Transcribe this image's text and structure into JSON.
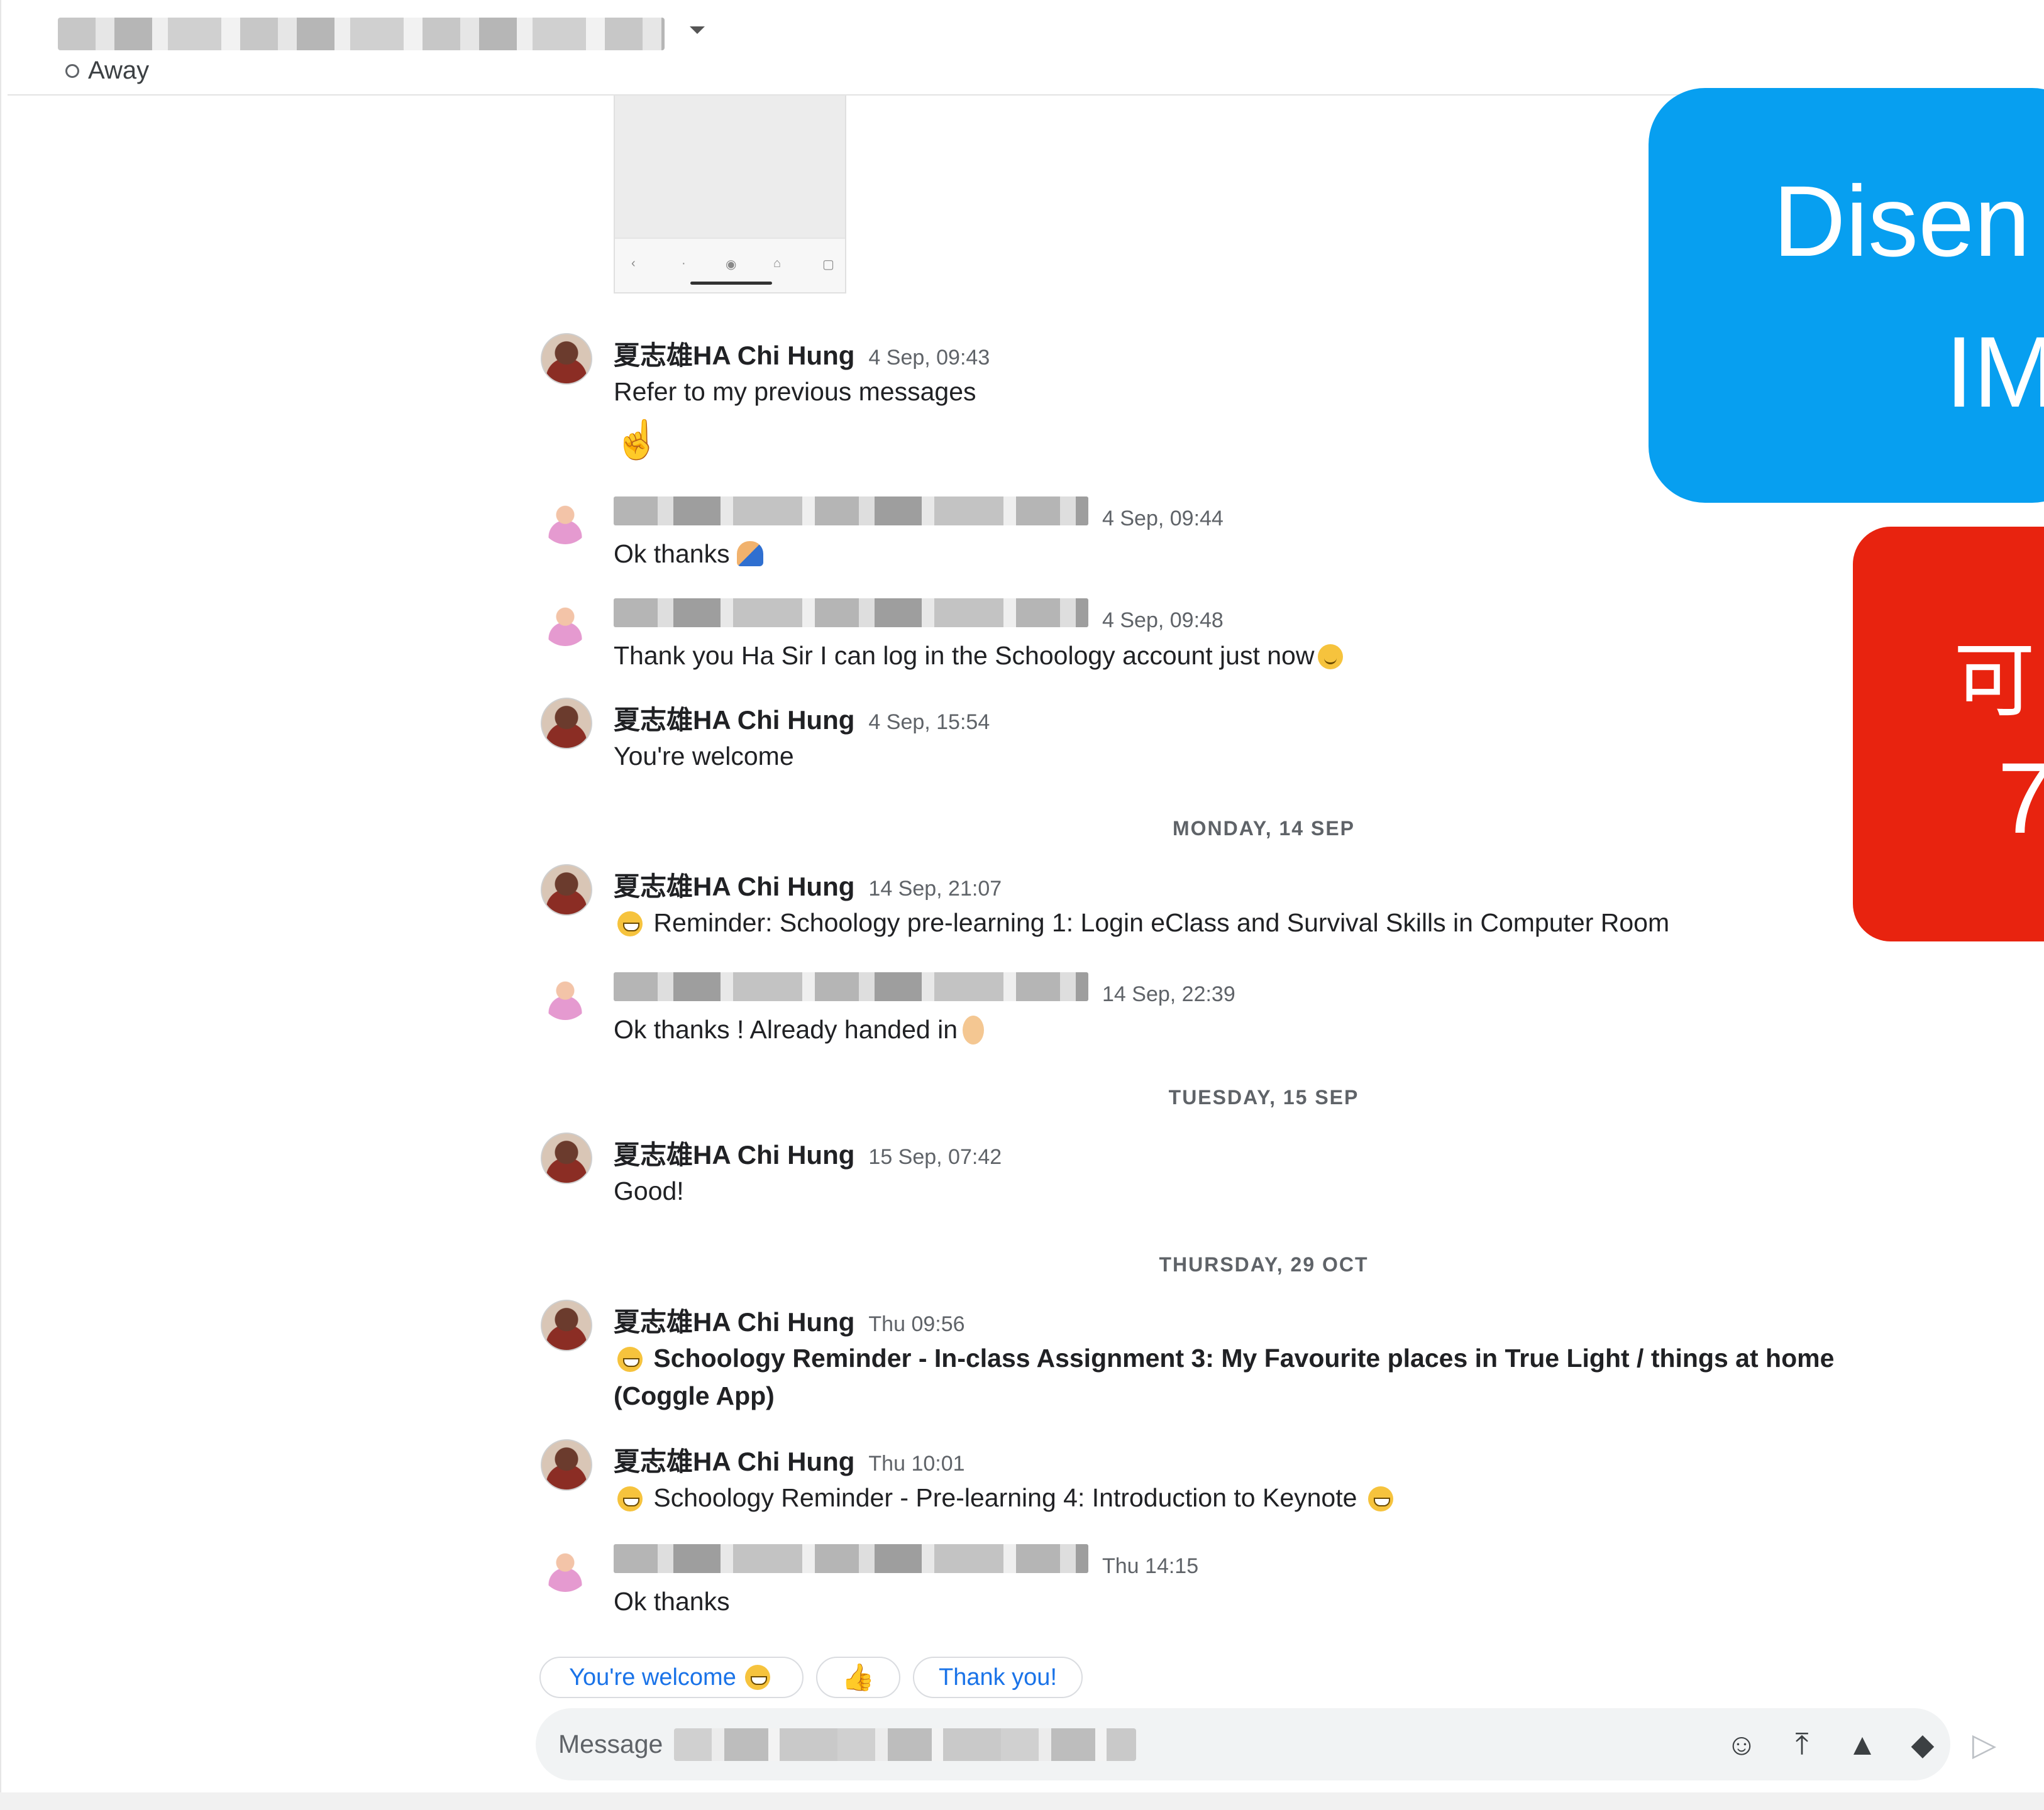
{
  "header": {
    "status": "Away"
  },
  "thumbnail": {
    "nav_symbols": [
      "‹",
      "·",
      "◉",
      "⌂",
      "▢"
    ]
  },
  "messages": [
    {
      "sender": "夏志雄HA Chi Hung",
      "time": "4 Sep, 09:43",
      "text": "Refer to my previous messages",
      "extra": "pointing-up-emoji"
    },
    {
      "sender": "",
      "time": "4 Sep, 09:44",
      "text": "Ok thanks",
      "extra": "folded-hands-emoji"
    },
    {
      "sender": "",
      "time": "4 Sep, 09:48",
      "text": "Thank you Ha Sir I can log in the Schoology account just now",
      "extra": "smiling-emoji"
    },
    {
      "sender": "夏志雄HA Chi Hung",
      "time": "4 Sep, 15:54",
      "text": "You're welcome"
    },
    {
      "sender": "夏志雄HA Chi Hung",
      "time": "14 Sep, 21:07",
      "text": "Reminder: Schoology pre-learning 1: Login eClass and Survival Skills in Computer Room",
      "extra": "grinning-emoji"
    },
    {
      "sender": "",
      "time": "14 Sep, 22:39",
      "text": "Ok thanks ! Already handed in",
      "extra": "ok-hand-emoji"
    },
    {
      "sender": "夏志雄HA Chi Hung",
      "time": "15 Sep, 07:42",
      "text": "Good!"
    },
    {
      "sender": "夏志雄HA Chi Hung",
      "time": "Thu 09:56",
      "text": "Schoology Reminder - In-class Assignment 3: My Favourite places in True Light / things at home",
      "text2": "(Coggle App)",
      "extra": "grinning-emoji"
    },
    {
      "sender": "夏志雄HA Chi Hung",
      "time": "Thu 10:01",
      "text": "Schoology Reminder - Pre-learning 4: Introduction to Keynote",
      "extra": "grinning-emoji"
    },
    {
      "sender": "",
      "time": "Thu 14:15",
      "text": "Ok thanks"
    }
  ],
  "day_separators": [
    "MONDAY, 14 SEP",
    "TUESDAY, 15 SEP",
    "THURSDAY, 29 OCT"
  ],
  "suggestions": [
    "You're welcome",
    "",
    "Thank you!"
  ],
  "composer": {
    "placeholder": "Message",
    "icons": [
      "emoji-icon",
      "upload-icon",
      "drive-icon",
      "meet-icon",
      "send-icon"
    ]
  },
  "overlay": {
    "blue_line1": "Disen",
    "blue_line2": "IM",
    "red_line1": "可",
    "red_line2": "7"
  },
  "colors": {
    "accent_blue": "#1a73e8",
    "overlay_blue": "#079ff0",
    "overlay_red": "#e8230f"
  }
}
